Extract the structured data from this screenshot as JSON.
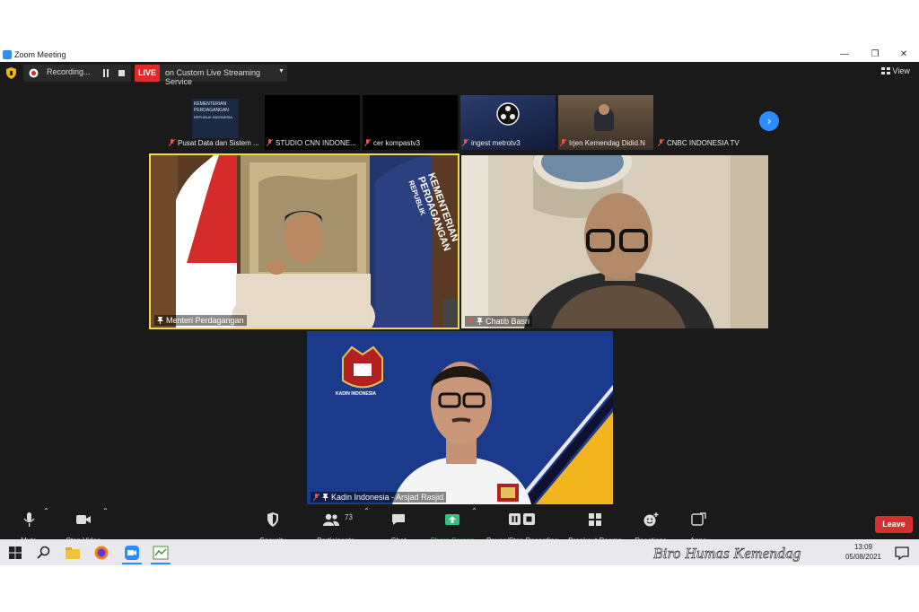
{
  "window": {
    "title": "Zoom Meeting"
  },
  "status": {
    "recording_label": "Recording...",
    "live_badge": "LIVE",
    "live_text": "on Custom Live Streaming Service",
    "view_label": "View"
  },
  "thumbnails": [
    {
      "name": "Pusat Data dan Sistem ...",
      "logo_lines": [
        "KEMENTERIAN",
        "PERDAGANGAN",
        "REPUBLIK INDONESIA"
      ]
    },
    {
      "name": "STUDIO CNN INDONE..."
    },
    {
      "name": "cer kompastv3"
    },
    {
      "name": "ingest metrotv3"
    },
    {
      "name": "Irjen Kemendag Didid.N"
    },
    {
      "name": "CNBC INDONESIA TV"
    }
  ],
  "tiles": {
    "menteri": {
      "name": "Menteri Perdagangan",
      "banner": [
        "KEMENTERIAN",
        "PERDAGANGAN",
        "REPUBLIK"
      ]
    },
    "chatib": {
      "name": "Chatib Basri"
    },
    "kadin": {
      "name": "Kadin Indonesia - Arsjad Rasjid",
      "logo_text": "KADIN INDONESIA"
    }
  },
  "toolbar": {
    "mute": "Mute",
    "stop_video": "Stop Video",
    "security": "Security",
    "participants": "Participants",
    "participants_count": "73",
    "chat": "Chat",
    "share_screen": "Share Screen",
    "pause_stop_recording": "Pause/Stop Recording",
    "breakout_rooms": "Breakout Rooms",
    "reactions": "Reactions",
    "apps": "Apps",
    "leave": "Leave"
  },
  "taskbar": {
    "time": "13:09",
    "date": "05/08/2021"
  },
  "watermark": "Biro Humas Kemendag",
  "colors": {
    "accent_blue": "#2d8cff",
    "live_red": "#e02b2b",
    "speaker_border": "#f2d64b",
    "share_green": "#2ec27e",
    "leave_red": "#d32f2f"
  }
}
